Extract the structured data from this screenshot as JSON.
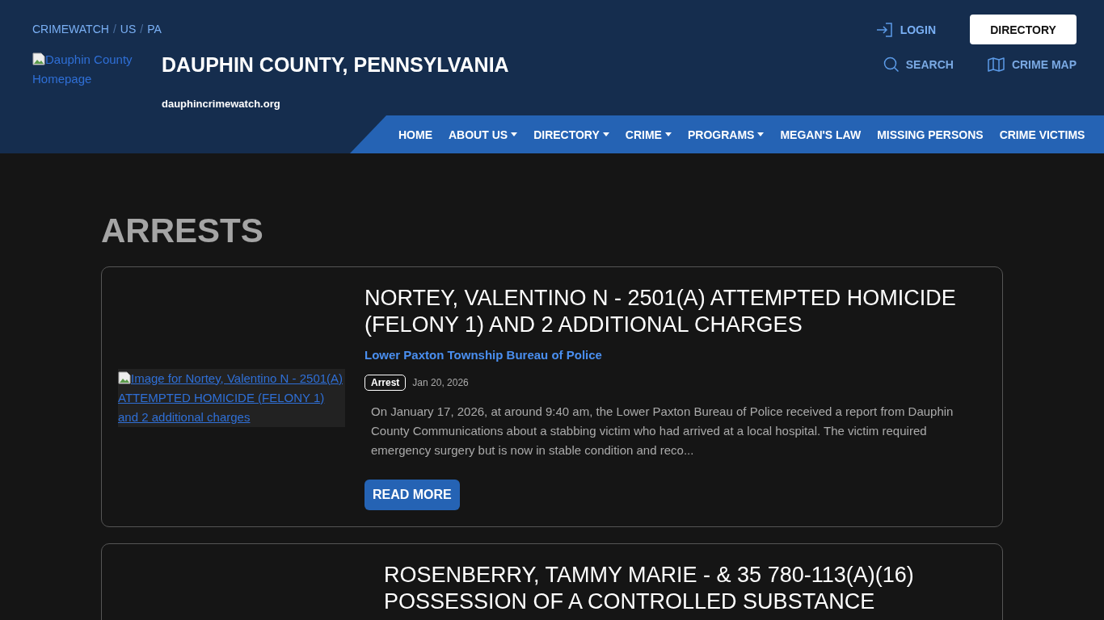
{
  "header": {
    "breadcrumb": [
      {
        "label": "CRIMEWATCH"
      },
      {
        "label": "US"
      },
      {
        "label": "PA"
      }
    ],
    "breadcrumb_separator": "/",
    "logo_alt": "Dauphin County Homepage",
    "site_title": "DAUPHIN COUNTY, PENNSYLVANIA",
    "site_url": "dauphincrimewatch.org",
    "login": "LOGIN",
    "directory_button": "DIRECTORY",
    "search": "SEARCH",
    "crime_map": "CRIME MAP"
  },
  "nav": [
    {
      "label": "HOME",
      "dropdown": false
    },
    {
      "label": "ABOUT US",
      "dropdown": true
    },
    {
      "label": "DIRECTORY",
      "dropdown": true
    },
    {
      "label": "CRIME",
      "dropdown": true
    },
    {
      "label": "PROGRAMS",
      "dropdown": true
    },
    {
      "label": "MEGAN'S LAW",
      "dropdown": false
    },
    {
      "label": "MISSING PERSONS",
      "dropdown": false
    },
    {
      "label": "CRIME VICTIMS",
      "dropdown": false
    }
  ],
  "page_title": "ARRESTS",
  "posts": [
    {
      "image_alt": "Image for Nortey, Valentino N - 2501(A) ATTEMPTED HOMICIDE (FELONY 1) and 2 additional charges",
      "title": "NORTEY, VALENTINO N - 2501(A) ATTEMPTED HOMICIDE (FELONY 1) AND 2 ADDITIONAL CHARGES",
      "agency": "Lower Paxton Township Bureau of Police",
      "tag": "Arrest",
      "date": "Jan 20, 2026",
      "excerpt": "On January 17, 2026, at around 9:40 am, the Lower Paxton Bureau of Police received a report from Dauphin County Communications about a stabbing victim who had arrived at a local hospital. The victim required emergency surgery but is now in stable condition and reco...",
      "button": "READ MORE"
    },
    {
      "title": "ROSENBERRY, TAMMY MARIE - & 35 780-113(A)(16) POSSESSION OF A CONTROLLED SUBSTANCE"
    }
  ]
}
